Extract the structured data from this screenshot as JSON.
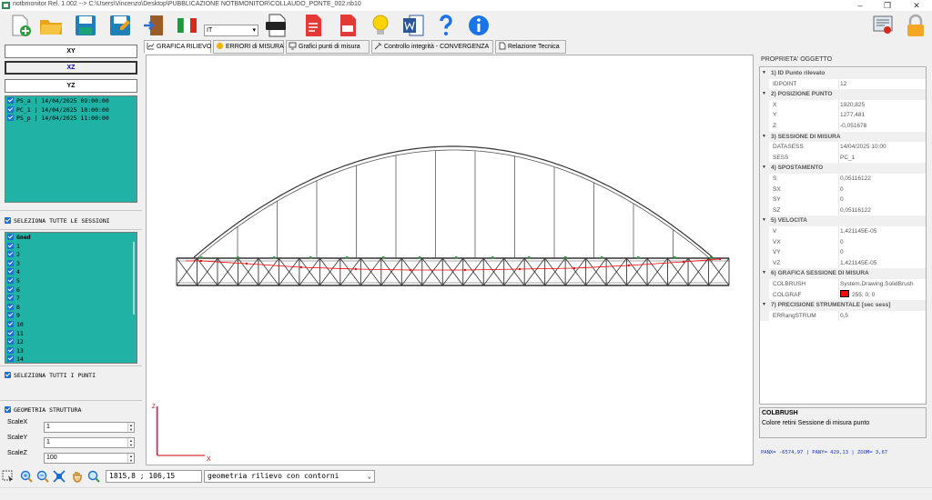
{
  "window": {
    "title": "notbmonitor Rel. 1.002 --> C:\\Users\\Vincenzo\\Desktop\\PUBBLICAZIONE NOTBMONITOR\\COLLAUDO_PONTE_002.nb10",
    "minimize": "–",
    "restore": "❐",
    "close": "✕"
  },
  "toolbar": {
    "language": "IT"
  },
  "tabs": [
    {
      "label": "GRAFICA RILIEVO",
      "active": true
    },
    {
      "label": "ERRORI di MISURA"
    },
    {
      "label": "Grafici punti di misura"
    },
    {
      "label": "Controllo integrità - CONVERGENZA"
    },
    {
      "label": "Relazione Tecnica"
    }
  ],
  "views": {
    "xy": "XY",
    "xz": "XZ",
    "yz": "YZ"
  },
  "sessions": [
    "PS_a | 14/04/2025 09:00:00",
    "PC_1 | 14/04/2025 10:00:00",
    "PS_p | 14/04/2025 11:00:00"
  ],
  "select_all_sessions": "SELEZIONA TUTTE  LE SESSIONI",
  "points": [
    "Gned",
    "1",
    "2",
    "3",
    "4",
    "5",
    "6",
    "7",
    "8",
    "9",
    "10",
    "11",
    "12",
    "13",
    "14"
  ],
  "select_all_points": "SELEZIONA TUTTI I PUNTI",
  "geometry": {
    "label": "GEOMETRIA STRUTTURA",
    "scale_x_label": "ScaleX",
    "scale_x": "1",
    "scale_y_label": "ScaleY",
    "scale_y": "1",
    "scale_z_label": "ScaleZ",
    "scale_z": "100"
  },
  "canvas": {
    "axis_z": "Z",
    "axis_x": "X"
  },
  "properties": {
    "title": "PROPRIETA' OGGETTO",
    "rows": [
      {
        "cat": "1) ID Punto rilevato"
      },
      {
        "name": "IDPOINT",
        "value": "12"
      },
      {
        "cat": "2) POSIZIONE PUNTO"
      },
      {
        "name": "X",
        "value": "1920,825"
      },
      {
        "name": "Y",
        "value": "1277,481"
      },
      {
        "name": "Z",
        "value": "-0,051678"
      },
      {
        "cat": "3) SESSIONE DI MISURA"
      },
      {
        "name": "DATASESS",
        "value": "14/04/2025 10:00"
      },
      {
        "name": "SESS",
        "value": "PC_1"
      },
      {
        "cat": "4) SPOSTAMENTO"
      },
      {
        "name": "S",
        "value": "0,05116122"
      },
      {
        "name": "SX",
        "value": "0"
      },
      {
        "name": "SY",
        "value": "0"
      },
      {
        "name": "SZ",
        "value": "0,05116122"
      },
      {
        "cat": "5) VELOCITA"
      },
      {
        "name": "V",
        "value": "1,421145E-05"
      },
      {
        "name": "VX",
        "value": "0"
      },
      {
        "name": "VY",
        "value": "0"
      },
      {
        "name": "VZ",
        "value": "1,421145E-05"
      },
      {
        "cat": "6) GRAFICA SESSIONE DI MISURA"
      },
      {
        "name": "COLBRUSH",
        "value": "System.Drawing.SolidBrush"
      },
      {
        "name": "COLGRAF",
        "value": "255; 0; 0",
        "swatch": "#ff0000"
      },
      {
        "cat": "7) PRECISIONE STRUMENTALE [sec sess]"
      },
      {
        "name": "ERRangSTRUM",
        "value": "0,5"
      }
    ],
    "desc_title": "COLBRUSH",
    "desc_text": "Colore retini Sessione di misura punto"
  },
  "pan_readout": "PANX= -6574,97 | PANY= 429,13 | ZOOM= 3,67",
  "bottom": {
    "coords": "1815,8 ; 106,15",
    "view_mode": "geometria rilievo con contorni"
  },
  "colors": {
    "teal": "#20b2a4",
    "checkbox": "#1a6fd1",
    "deformed_line": "#ff0000",
    "axis": "#cc0000"
  }
}
